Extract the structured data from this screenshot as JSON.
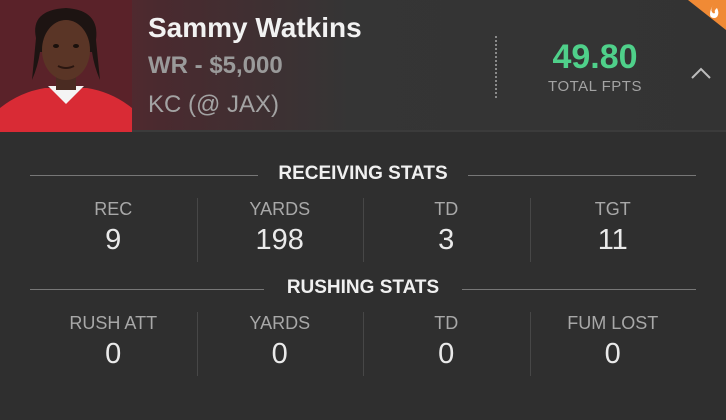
{
  "player": {
    "name": "Sammy Watkins",
    "position_salary": "WR - $5,000",
    "game": "KC (@ JAX)",
    "fpts_value": "49.80",
    "fpts_label": "TOTAL FPTS"
  },
  "icons": {
    "collapse": "chevron-up-icon",
    "hot": "flame-icon"
  },
  "colors": {
    "fpts": "#4fd08a",
    "hot_flag": "#f08a35",
    "jersey": "#d92b35"
  },
  "receiving": {
    "title": "RECEIVING STATS",
    "stats": [
      {
        "label": "REC",
        "value": "9"
      },
      {
        "label": "YARDS",
        "value": "198"
      },
      {
        "label": "TD",
        "value": "3"
      },
      {
        "label": "TGT",
        "value": "11"
      }
    ]
  },
  "rushing": {
    "title": "RUSHING STATS",
    "stats": [
      {
        "label": "RUSH ATT",
        "value": "0"
      },
      {
        "label": "YARDS",
        "value": "0"
      },
      {
        "label": "TD",
        "value": "0"
      },
      {
        "label": "FUM LOST",
        "value": "0"
      }
    ]
  }
}
